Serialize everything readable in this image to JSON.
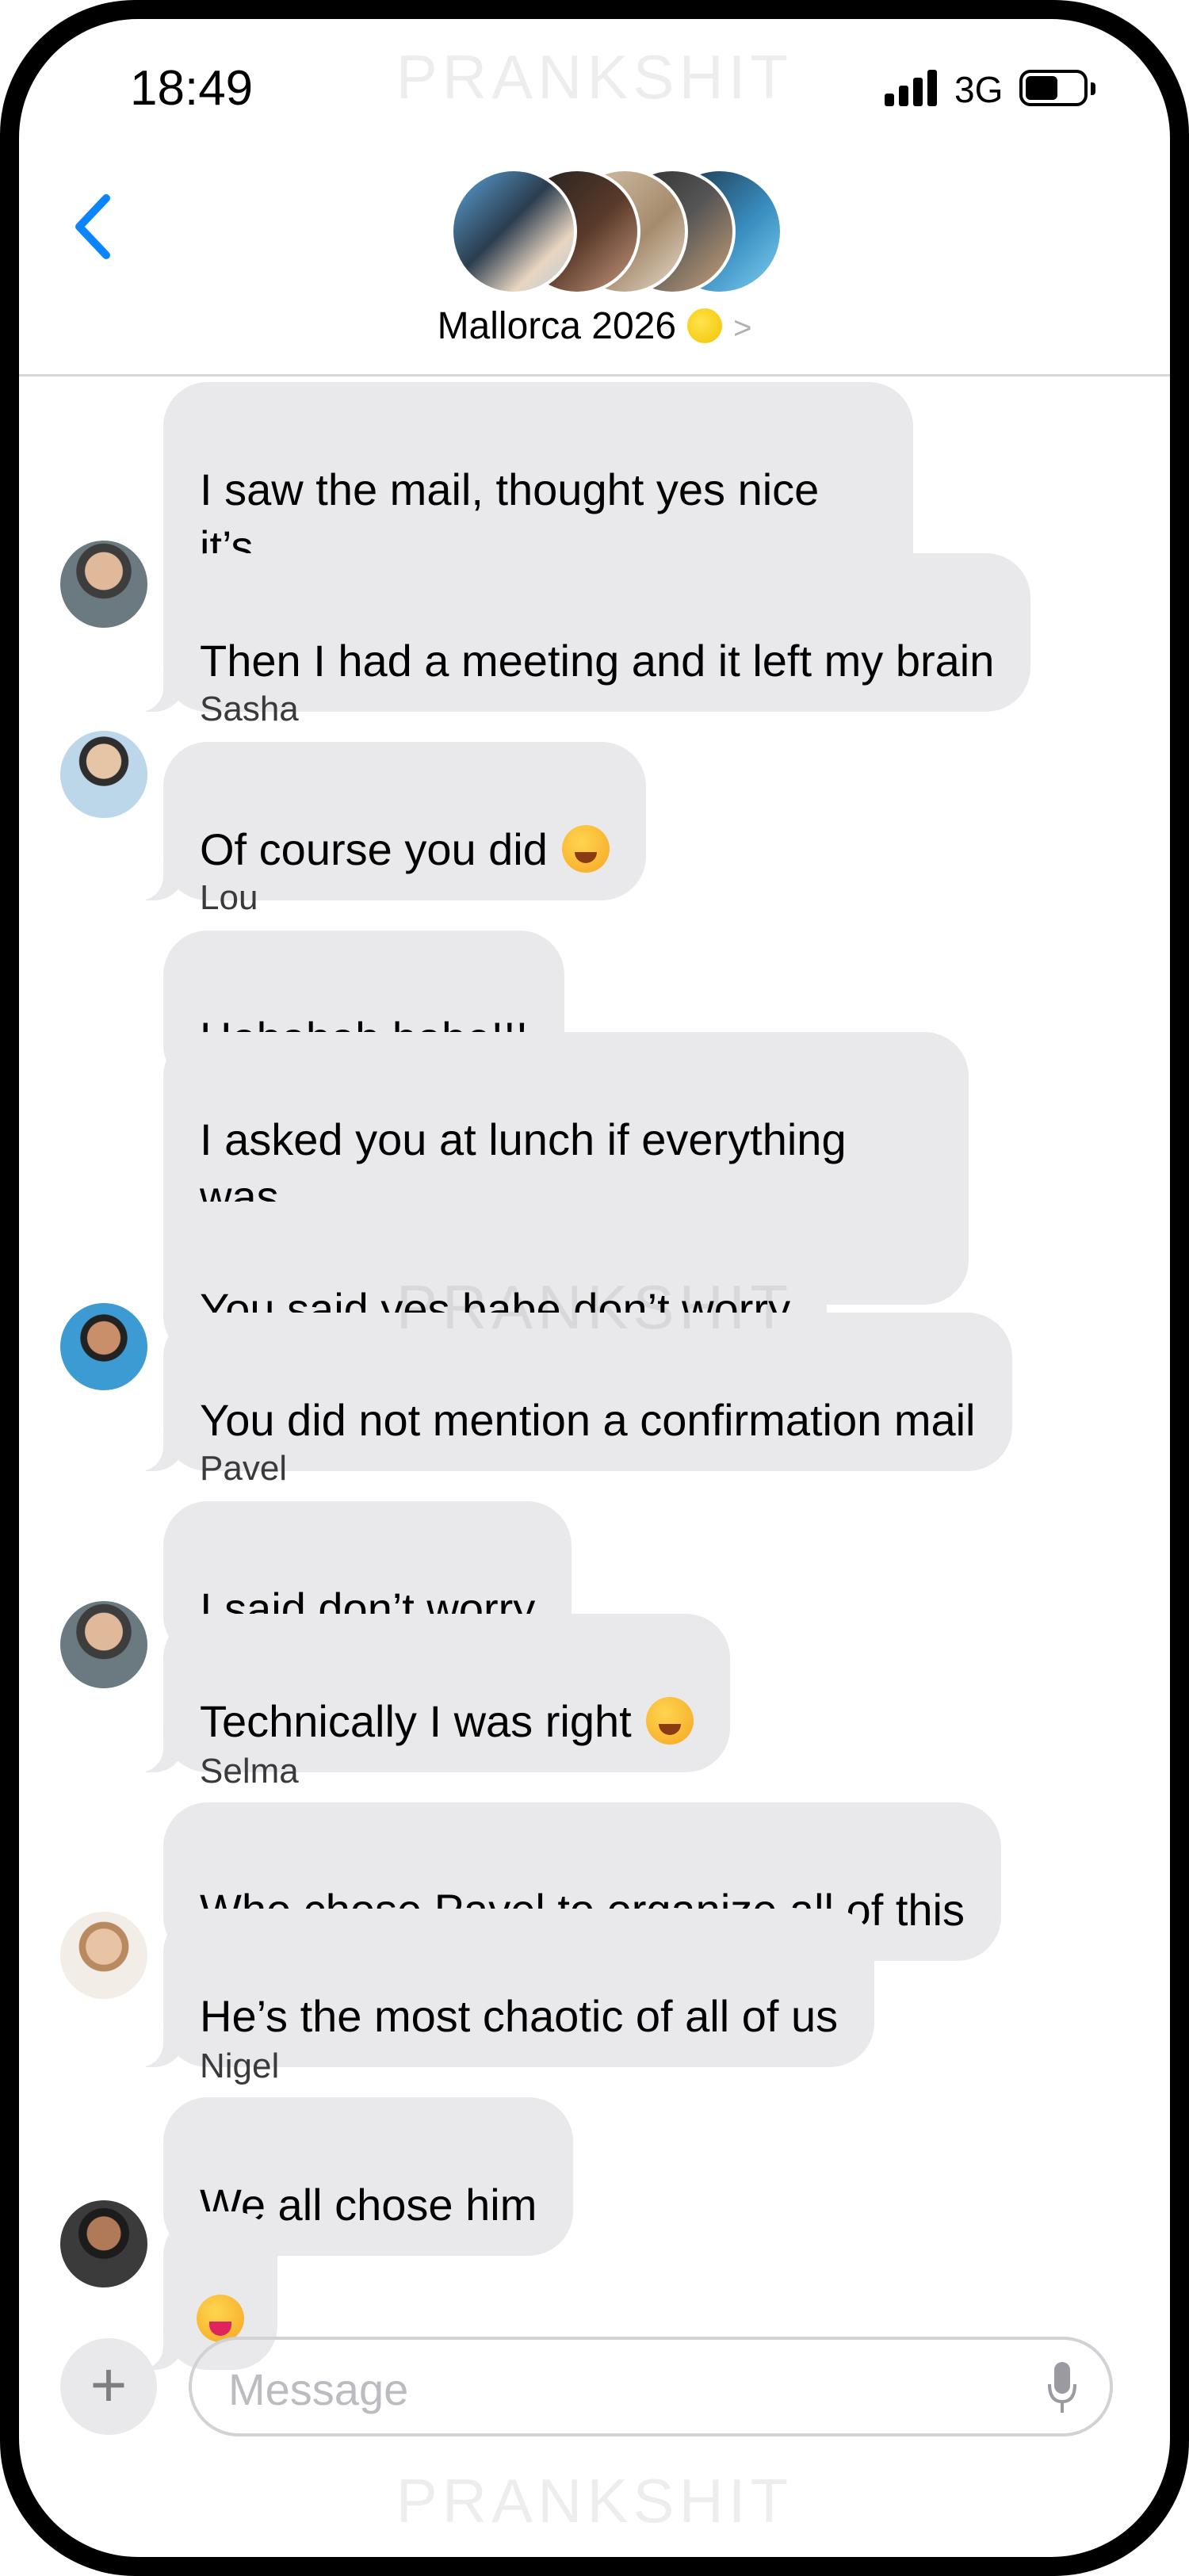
{
  "status_bar": {
    "time": "18:49",
    "network": "3G"
  },
  "header": {
    "group_name": "Mallorca 2026"
  },
  "watermark": "PRANKSHIT",
  "composer": {
    "placeholder": "Message"
  },
  "colors": {
    "accent": "#0a84ff",
    "bubble": "#e9e9eb"
  },
  "icons": {
    "back": "chevron-left-icon",
    "plus": "plus-icon",
    "mic": "microphone-icon",
    "lemon": "lemon-emoji"
  },
  "messages": [
    {
      "text": "I saw the mail, thought yes nice it’s\ndone!!"
    },
    {
      "text": "Then I had a meeting and it left my brain"
    },
    {
      "sender": "Sasha",
      "text": "Of course you did",
      "emoji": "rolling-on-floor-laughing-emoji"
    },
    {
      "sender": "Lou",
      "text": "Hahahah babe!!!"
    },
    {
      "text": "I asked you at lunch if everything was\nokay for the trip"
    },
    {
      "text": "You said yes babe don’t worry"
    },
    {
      "text": "You did not mention a confirmation mail"
    },
    {
      "sender": "Pavel",
      "text": "I said don’t worry"
    },
    {
      "text": "Technically I was right",
      "emoji": "winking-face-emoji"
    },
    {
      "sender": "Selma",
      "text": "Who chose Pavel to organize all of this"
    },
    {
      "text": "He’s the most chaotic of all of us"
    },
    {
      "sender": "Nigel",
      "text": "We all chose him"
    },
    {
      "text": "",
      "emoji": "squinting-face-with-tongue-emoji"
    }
  ]
}
